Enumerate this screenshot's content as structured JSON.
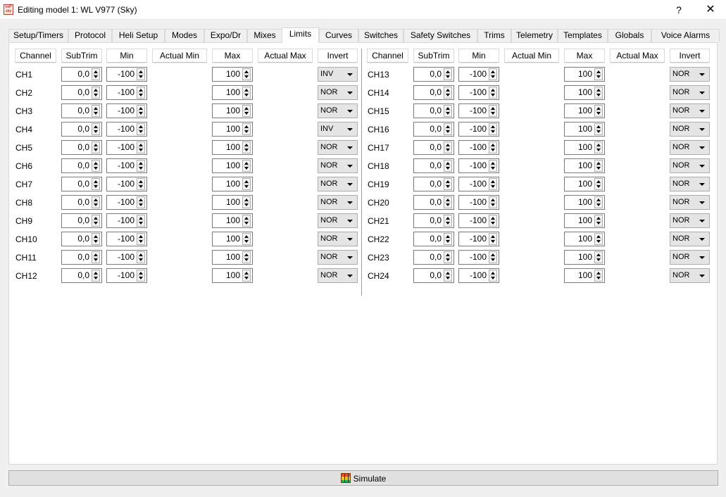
{
  "window": {
    "title": "Editing model 1: WL V977 (Sky)",
    "help_label": "?",
    "close_label": "✕",
    "app_icon_text": [
      "eeP",
      "sky"
    ]
  },
  "tabs": [
    {
      "label": "Setup/Timers",
      "active": false
    },
    {
      "label": "Protocol",
      "active": false
    },
    {
      "label": "Heli Setup",
      "active": false
    },
    {
      "label": "Modes",
      "active": false
    },
    {
      "label": "Expo/Dr",
      "active": false
    },
    {
      "label": "Mixes",
      "active": false
    },
    {
      "label": "Limits",
      "active": true
    },
    {
      "label": "Curves",
      "active": false
    },
    {
      "label": "Switches",
      "active": false
    },
    {
      "label": "Safety Switches",
      "active": false
    },
    {
      "label": "Trims",
      "active": false
    },
    {
      "label": "Telemetry",
      "active": false
    },
    {
      "label": "Templates",
      "active": false
    },
    {
      "label": "Globals",
      "active": false
    },
    {
      "label": "Voice Alarms",
      "active": false
    }
  ],
  "columns": [
    "Channel",
    "SubTrim",
    "Min",
    "Actual Min",
    "Max",
    "Actual Max",
    "Invert"
  ],
  "channels_left": [
    {
      "name": "CH1",
      "subtrim": "0,0",
      "min": "-100",
      "max": "100",
      "invert": "INV"
    },
    {
      "name": "CH2",
      "subtrim": "0,0",
      "min": "-100",
      "max": "100",
      "invert": "NOR"
    },
    {
      "name": "CH3",
      "subtrim": "0,0",
      "min": "-100",
      "max": "100",
      "invert": "NOR"
    },
    {
      "name": "CH4",
      "subtrim": "0,0",
      "min": "-100",
      "max": "100",
      "invert": "INV"
    },
    {
      "name": "CH5",
      "subtrim": "0,0",
      "min": "-100",
      "max": "100",
      "invert": "NOR"
    },
    {
      "name": "CH6",
      "subtrim": "0,0",
      "min": "-100",
      "max": "100",
      "invert": "NOR"
    },
    {
      "name": "CH7",
      "subtrim": "0,0",
      "min": "-100",
      "max": "100",
      "invert": "NOR"
    },
    {
      "name": "CH8",
      "subtrim": "0,0",
      "min": "-100",
      "max": "100",
      "invert": "NOR"
    },
    {
      "name": "CH9",
      "subtrim": "0,0",
      "min": "-100",
      "max": "100",
      "invert": "NOR"
    },
    {
      "name": "CH10",
      "subtrim": "0,0",
      "min": "-100",
      "max": "100",
      "invert": "NOR"
    },
    {
      "name": "CH11",
      "subtrim": "0,0",
      "min": "-100",
      "max": "100",
      "invert": "NOR"
    },
    {
      "name": "CH12",
      "subtrim": "0,0",
      "min": "-100",
      "max": "100",
      "invert": "NOR"
    }
  ],
  "channels_right": [
    {
      "name": "CH13",
      "subtrim": "0,0",
      "min": "-100",
      "max": "100",
      "invert": "NOR"
    },
    {
      "name": "CH14",
      "subtrim": "0,0",
      "min": "-100",
      "max": "100",
      "invert": "NOR"
    },
    {
      "name": "CH15",
      "subtrim": "0,0",
      "min": "-100",
      "max": "100",
      "invert": "NOR"
    },
    {
      "name": "CH16",
      "subtrim": "0,0",
      "min": "-100",
      "max": "100",
      "invert": "NOR"
    },
    {
      "name": "CH17",
      "subtrim": "0,0",
      "min": "-100",
      "max": "100",
      "invert": "NOR"
    },
    {
      "name": "CH18",
      "subtrim": "0,0",
      "min": "-100",
      "max": "100",
      "invert": "NOR"
    },
    {
      "name": "CH19",
      "subtrim": "0,0",
      "min": "-100",
      "max": "100",
      "invert": "NOR"
    },
    {
      "name": "CH20",
      "subtrim": "0,0",
      "min": "-100",
      "max": "100",
      "invert": "NOR"
    },
    {
      "name": "CH21",
      "subtrim": "0,0",
      "min": "-100",
      "max": "100",
      "invert": "NOR"
    },
    {
      "name": "CH22",
      "subtrim": "0,0",
      "min": "-100",
      "max": "100",
      "invert": "NOR"
    },
    {
      "name": "CH23",
      "subtrim": "0,0",
      "min": "-100",
      "max": "100",
      "invert": "NOR"
    },
    {
      "name": "CH24",
      "subtrim": "0,0",
      "min": "-100",
      "max": "100",
      "invert": "NOR"
    }
  ],
  "simulate": {
    "label": "Simulate",
    "icon": "simulator-icon"
  }
}
